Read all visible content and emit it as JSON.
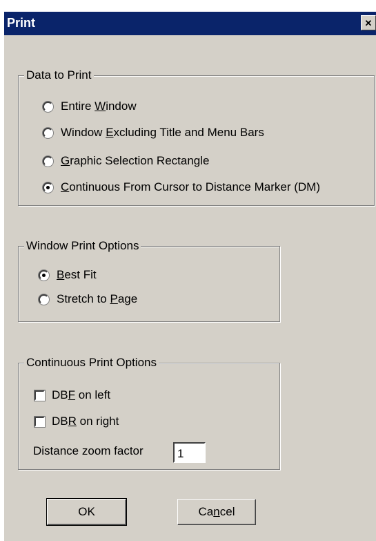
{
  "dialog": {
    "title": "Print",
    "close_glyph": "✕"
  },
  "data_to_print": {
    "legend": "Data to Print",
    "options": [
      {
        "pre": "Entire ",
        "ul": "W",
        "post": "indow",
        "checked": false
      },
      {
        "pre": "Window ",
        "ul": "E",
        "post": "xcluding Title and Menu Bars",
        "checked": false
      },
      {
        "pre": "",
        "ul": "G",
        "post": "raphic Selection Rectangle",
        "checked": false
      },
      {
        "pre": "",
        "ul": "C",
        "post": "ontinuous From Cursor to Distance Marker (DM)",
        "checked": true
      }
    ]
  },
  "window_print_options": {
    "legend": "Window Print Options",
    "options": [
      {
        "pre": "",
        "ul": "B",
        "post": "est Fit",
        "checked": true
      },
      {
        "pre": "Stretch to ",
        "ul": "P",
        "post": "age",
        "checked": false
      }
    ]
  },
  "continuous_print_options": {
    "legend": "Continuous Print Options",
    "checkboxes": [
      {
        "pre": "DB",
        "ul": "F",
        "post": " on left",
        "checked": false
      },
      {
        "pre": "DB",
        "ul": "R",
        "post": " on right",
        "checked": false
      }
    ],
    "zoom_label": "Distance zoom factor",
    "zoom_value": "1"
  },
  "buttons": {
    "ok_label": "OK",
    "cancel_pre": "Ca",
    "cancel_ul": "n",
    "cancel_post": "cel"
  }
}
